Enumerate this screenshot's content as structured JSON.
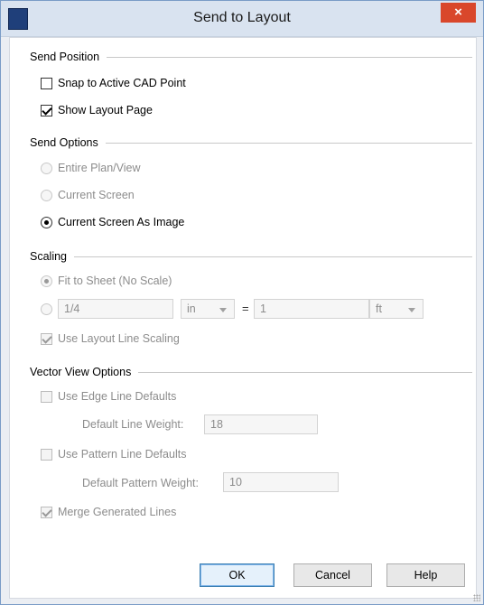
{
  "window": {
    "title": "Send to Layout",
    "close_label": "×"
  },
  "send_position": {
    "heading": "Send Position",
    "snap_label": "Snap to Active CAD Point",
    "snap_checked": false,
    "show_layout_label": "Show Layout Page",
    "show_layout_checked": true
  },
  "send_options": {
    "heading": "Send Options",
    "options": [
      "Entire Plan/View",
      "Current Screen",
      "Current Screen As Image"
    ],
    "selected": "Current Screen As Image"
  },
  "scaling": {
    "heading": "Scaling",
    "fit_label": "Fit to Sheet (No Scale)",
    "scale_value": "1/4",
    "scale_unit": "in",
    "equals": "=",
    "target_value": "1",
    "target_unit": "ft",
    "use_layout_scaling_label": "Use Layout Line Scaling"
  },
  "vector": {
    "heading": "Vector View Options",
    "edge_label": "Use Edge Line Defaults",
    "line_weight_label": "Default Line Weight:",
    "line_weight_value": "18",
    "pattern_label": "Use Pattern Line Defaults",
    "pattern_weight_label": "Default Pattern Weight:",
    "pattern_weight_value": "10",
    "merge_label": "Merge Generated Lines"
  },
  "buttons": {
    "ok": "OK",
    "cancel": "Cancel",
    "help": "Help"
  }
}
